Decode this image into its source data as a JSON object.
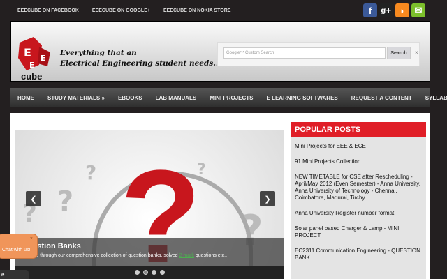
{
  "toplinks": [
    "EEECUBE ON FACEBOOK",
    "EEECUBE ON GOOGLE+",
    "EEECUBE ON NOKIA STORE"
  ],
  "social": [
    {
      "icon": "facebook-icon",
      "glyph": "f",
      "color": "#3b5998"
    },
    {
      "icon": "google-plus-icon",
      "glyph": "g+",
      "color": "#222"
    },
    {
      "icon": "rss-icon",
      "glyph": "◗",
      "color": "#f7891f"
    },
    {
      "icon": "email-icon",
      "glyph": "✉",
      "color": "#7cbf2b"
    }
  ],
  "header": {
    "logo_text": "cube",
    "tagline_1": "Everything that an",
    "tagline_2": "Electrical Engineering student needs..."
  },
  "search": {
    "placeholder": "Google™ Custom Search",
    "button": "Search",
    "clear": "×"
  },
  "nav": [
    "HOME",
    "STUDY MATERIALS »",
    "EBOOKS",
    "LAB MANUALS",
    "MINI PROJECTS",
    "E LEARNING SOFTWARES",
    "REQUEST A CONTENT",
    "SYLLABUS »"
  ],
  "slider": {
    "title": "Question Banks",
    "desc_before": "Browse through our comprehensive collection of question banks, solved ",
    "desc_link": "2 mark",
    "desc_after": " questions etc.,",
    "prev": "❮",
    "next": "❯",
    "active_slide": 2,
    "slide_count": 4
  },
  "sidebar": {
    "title": "POPULAR POSTS",
    "posts": [
      "Mini Projects for EEE & ECE",
      "91 Mini Projects Collection",
      "NEW TIMETABLE for CSE after Rescheduling - April/May 2012 (Even Semester) - Anna University, Anna University of Technology - Chennai, Coimbatore, Madurai, Tirchy",
      "Anna University Register number format",
      "Solar panel based Charger & Lamp - MINI PROJECT",
      "EC2311 Communication Engineering - QUESTION BANK"
    ]
  },
  "chat": {
    "text": "Chat with us!",
    "close": "×",
    "tab": "e"
  }
}
